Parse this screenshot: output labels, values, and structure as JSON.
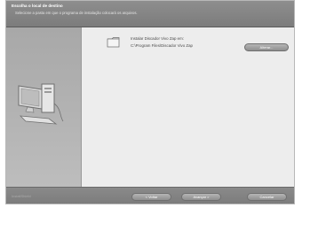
{
  "header": {
    "title": "Escolha o local de destino",
    "subtitle": "Selecione a pasta em que o programa de instalação colocará os arquivos."
  },
  "left_panel": {
    "illustration": "computer-icon"
  },
  "content": {
    "install_label": "Instalar Discador Vivo Zap em:",
    "install_path": "C:\\Program Files\\Discador Vivo Zap",
    "browse_label": "Alterar..."
  },
  "footer": {
    "brand": "InstallShield",
    "back_label": "< Voltar",
    "next_label": "Avançar >",
    "cancel_label": "Cancelar"
  }
}
